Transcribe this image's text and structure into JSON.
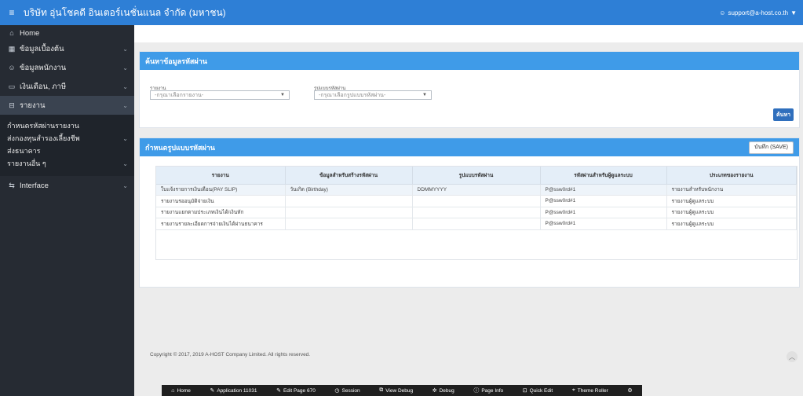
{
  "header": {
    "title": "บริษัท อุ่นโชคดี อินเตอร์เนชั่นแนล จำกัด (มหาชน)",
    "menu_icon": "hamburger-icon",
    "user": "support@a-host.co.th",
    "user_caret": "▼"
  },
  "sidebar": {
    "home": "Home",
    "items": [
      {
        "label": "ข้อมูลเบื้องต้น",
        "icon": "table-icon",
        "chev": "⌄"
      },
      {
        "label": "ข้อมูลพนักงาน",
        "icon": "user-icon",
        "chev": "⌄"
      },
      {
        "label": "เงินเดือน, ภาษี",
        "icon": "money-icon",
        "chev": "⌄"
      },
      {
        "label": "รายงาน",
        "icon": "folder-icon",
        "chev": "⌄"
      }
    ],
    "report_sub": [
      {
        "label": "กำหนดรหัสผ่านรายงาน",
        "chev": ""
      },
      {
        "label": "ส่งกองทุนสำรองเลี้ยงชีพ",
        "chev": "⌄"
      },
      {
        "label": "ส่งธนาคาร",
        "chev": ""
      },
      {
        "label": "รายงานอื่น ๆ",
        "chev": "⌄"
      }
    ],
    "interface": {
      "label": "Interface",
      "icon": "shuffle-icon",
      "chev": "⌄"
    }
  },
  "search_panel": {
    "title": "ค้นหาข้อมูลรหัสผ่าน",
    "report_label": "รายงาน",
    "report_placeholder": "-กรุณาเลือกรายงาน-",
    "format_label": "รูปแบบรหัสผ่าน",
    "format_placeholder": "-กรุณาเลือกรูปแบบรหัสผ่าน-",
    "search_button": "ค้นหา"
  },
  "format_panel": {
    "title": "กำหนดรูปแบบรหัสผ่าน",
    "save_button": "บันทึก (SAVE)",
    "columns": [
      "รายงาน",
      "ข้อมูลสำหรับสร้างรหัสผ่าน",
      "รูปแบบรหัสผ่าน",
      "รหัสผ่านสำหรับผู้ดูแลระบบ",
      "ประเภทของรายงาน"
    ],
    "rows": [
      [
        "ใบแจ้งรายการเงินเดือน(PAY SLIP)",
        "วันเกิด (Birthday)",
        "DDMMYYYY",
        "P@ssw0rd#1",
        "รายงานสำหรับพนักงาน"
      ],
      [
        "รายงานรออนุมัติจ่ายเงิน",
        "",
        "",
        "P@ssw0rd#1",
        "รายงานผู้ดูแลระบบ"
      ],
      [
        "รายงานแยกตามประเภทเงินได้/เงินหัก",
        "",
        "",
        "P@ssw0rd#1",
        "รายงานผู้ดูแลระบบ"
      ],
      [
        "รายงานรายละเอียดการจ่ายเงินได้ผ่านธนาคาร",
        "",
        "",
        "P@ssw0rd#1",
        "รายงานผู้ดูแลระบบ"
      ]
    ]
  },
  "footer": {
    "copyright": "Copyright © 2017, 2019 A-HOST Company Limited. All rights reserved."
  },
  "devbar": {
    "items": [
      {
        "label": "Home",
        "icon": "⌂"
      },
      {
        "label": "Application 11031",
        "icon": "✎"
      },
      {
        "label": "Edit Page 670",
        "icon": "✎"
      },
      {
        "label": "Session",
        "icon": "◷"
      },
      {
        "label": "View Debug",
        "icon": "⧉"
      },
      {
        "label": "Debug",
        "icon": "✲"
      },
      {
        "label": "Page Info",
        "icon": "ⓘ"
      },
      {
        "label": "Quick Edit",
        "icon": "⊡"
      },
      {
        "label": "Theme Roller",
        "icon": "⌖"
      },
      {
        "label": "",
        "icon": "⚙"
      }
    ]
  },
  "colors": {
    "topbar": "#2e7fd6",
    "sidebar": "#262b33",
    "panel_header": "#3f9be8",
    "search_button": "#2f6fbd"
  }
}
